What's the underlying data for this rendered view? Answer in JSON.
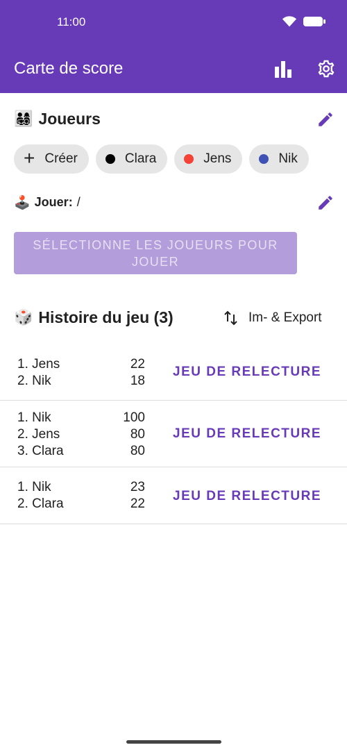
{
  "status": {
    "time": "11:00"
  },
  "header": {
    "title": "Carte de score"
  },
  "players": {
    "emoji": "👨‍👩‍👧‍👦",
    "title": "Joueurs",
    "create_label": "Créer",
    "chips": [
      {
        "name": "Clara",
        "color": "#000000"
      },
      {
        "name": "Jens",
        "color": "#f44336"
      },
      {
        "name": "Nik",
        "color": "#3f51b5"
      }
    ]
  },
  "play": {
    "emoji": "🕹️",
    "label": "Jouer:",
    "value": "/"
  },
  "select_button": {
    "label": "SÉLECTIONNE LES JOUEURS POUR JOUER"
  },
  "history": {
    "emoji": "🎲",
    "title": "Histoire du jeu (3)",
    "export_label": "Im- & Export",
    "games": [
      {
        "ranks": [
          "1. Jens",
          "2. Nik"
        ],
        "scores": [
          "22",
          "18"
        ],
        "replay_label": "JEU DE RELECTURE"
      },
      {
        "ranks": [
          "1. Nik",
          "2. Jens",
          "3. Clara"
        ],
        "scores": [
          "100",
          "80",
          "80"
        ],
        "replay_label": "JEU DE RELECTURE"
      },
      {
        "ranks": [
          "1. Nik",
          "2. Clara"
        ],
        "scores": [
          "23",
          "22"
        ],
        "replay_label": "JEU DE RELECTURE"
      }
    ]
  },
  "colors": {
    "primary": "#673ab7",
    "disabled_button": "#b39ddb"
  }
}
